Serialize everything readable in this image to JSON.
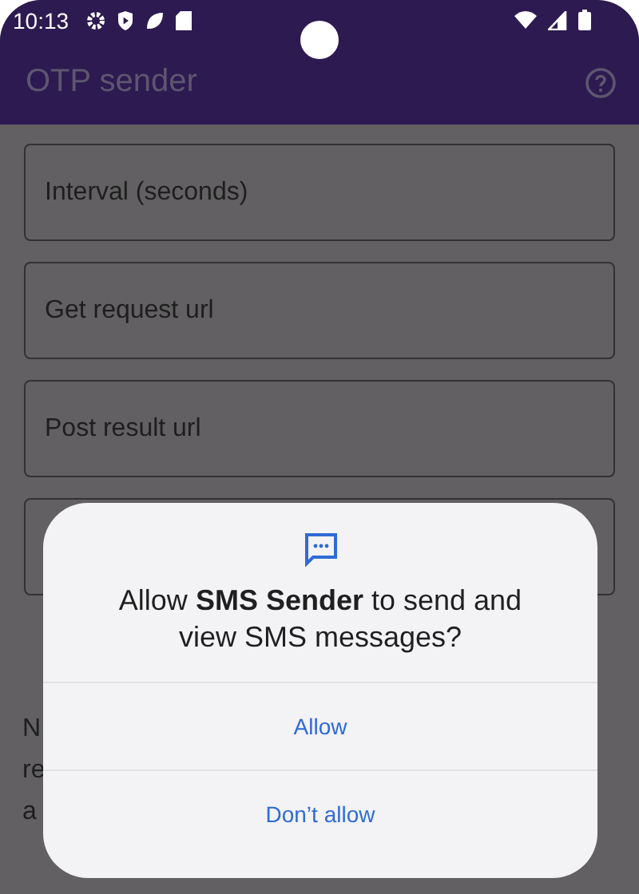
{
  "status_bar": {
    "time": "10:13"
  },
  "app_bar": {
    "title": "OTP sender"
  },
  "fields": [
    {
      "kind": "text",
      "placeholder": "Interval (seconds)"
    },
    {
      "kind": "text",
      "placeholder": "Get request url"
    },
    {
      "kind": "text",
      "placeholder": "Post result url"
    },
    {
      "kind": "text"
    }
  ],
  "note_lines": [
    "N",
    "re",
    "a"
  ],
  "dialog": {
    "message": "Allow **SMS Sender** to send and view SMS messages?",
    "buttons": [
      "Allow",
      "Don’t allow"
    ]
  }
}
